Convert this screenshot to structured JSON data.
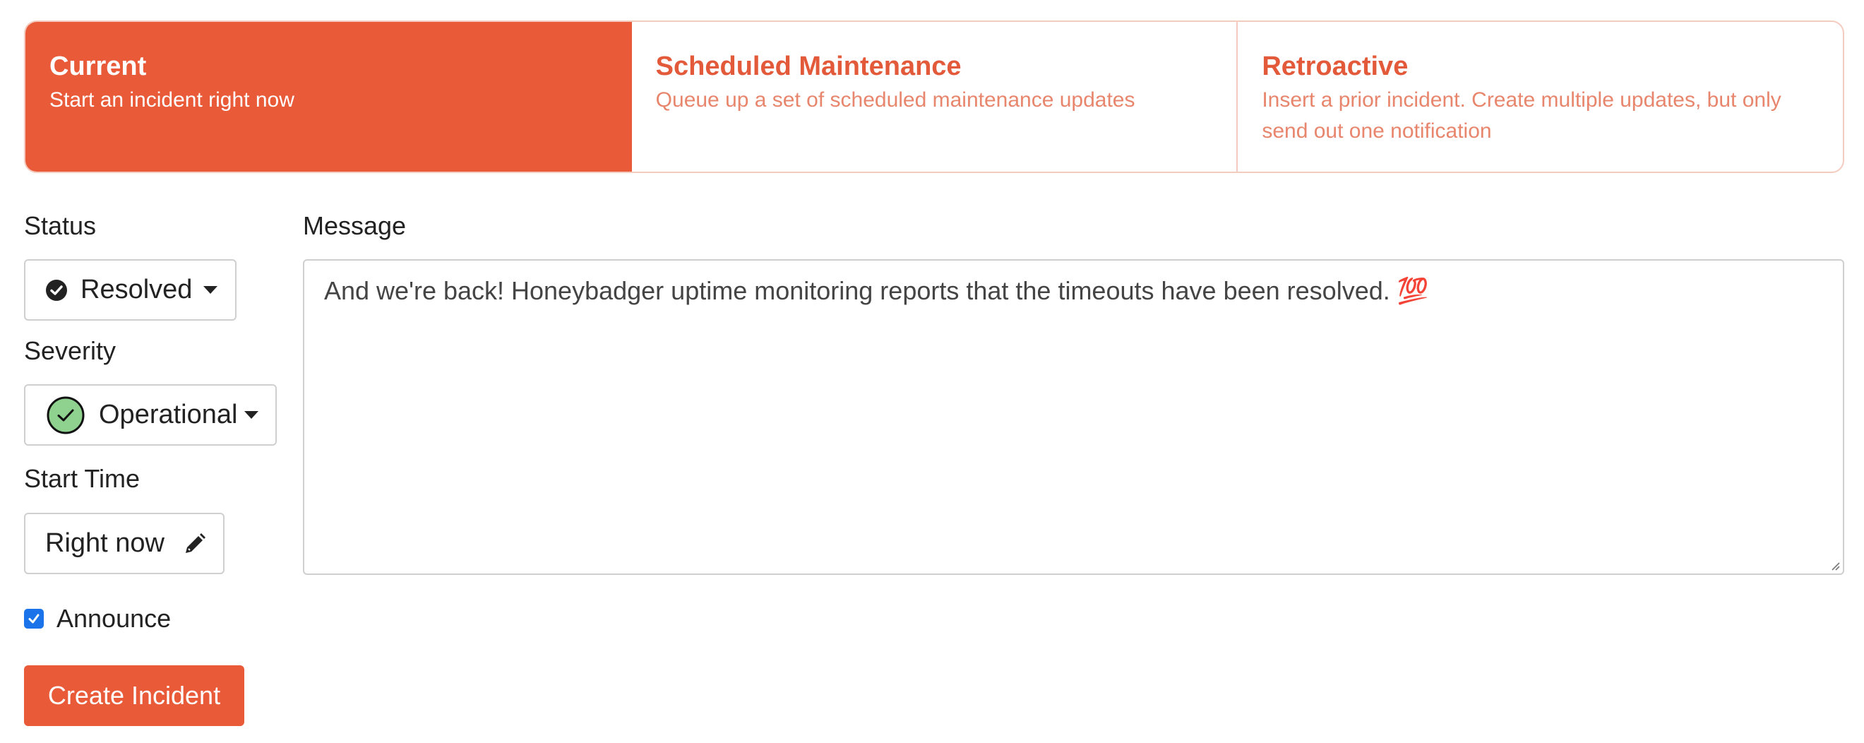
{
  "tabs": [
    {
      "title": "Current",
      "description": "Start an incident right now",
      "active": true
    },
    {
      "title": "Scheduled Maintenance",
      "description": "Queue up a set of scheduled maintenance updates",
      "active": false
    },
    {
      "title": "Retroactive",
      "description": "Insert a prior incident. Create multiple updates, but only send out one notification",
      "active": false
    }
  ],
  "form": {
    "status_label": "Status",
    "status_value": "Resolved",
    "severity_label": "Severity",
    "severity_value": "Operational",
    "start_time_label": "Start Time",
    "start_time_value": "Right now",
    "message_label": "Message",
    "message_value": "And we're back! Honeybadger uptime monitoring reports that the timeouts have been resolved. 💯",
    "announce_label": "Announce",
    "announce_checked": true,
    "submit_label": "Create Incident"
  },
  "icons": {
    "status": "check-circle-icon",
    "severity": "green-check-circle-icon",
    "start_time": "pencil-icon"
  },
  "colors": {
    "accent": "#e95a39",
    "severity_operational": "#8fd18f",
    "checkbox": "#1a73e8"
  }
}
